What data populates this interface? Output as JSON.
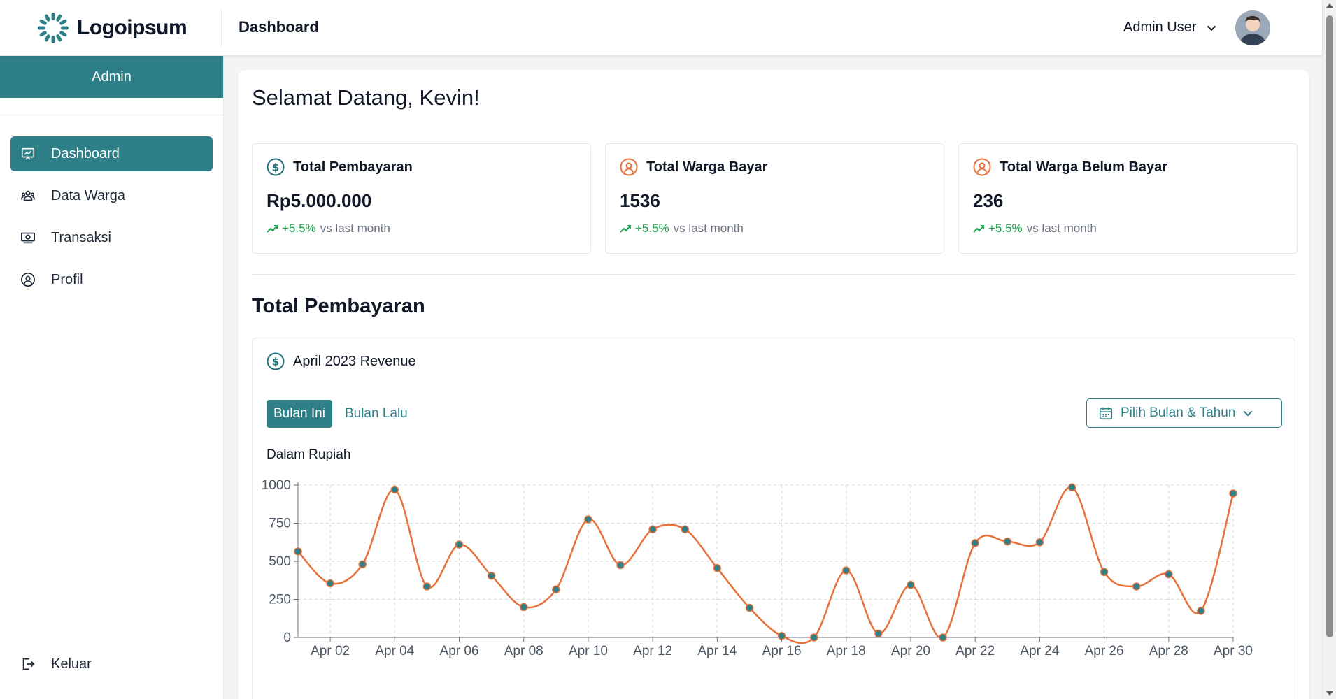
{
  "header": {
    "logo_text": "Logoipsum",
    "page_title": "Dashboard",
    "user_name": "Admin User"
  },
  "sidebar": {
    "role_label": "Admin",
    "items": [
      {
        "label": "Dashboard",
        "icon": "presentation-chart-icon",
        "active": true
      },
      {
        "label": "Data Warga",
        "icon": "users-icon",
        "active": false
      },
      {
        "label": "Transaksi",
        "icon": "money-icon",
        "active": false
      },
      {
        "label": "Profil",
        "icon": "user-circle-icon",
        "active": false
      }
    ],
    "logout_label": "Keluar"
  },
  "main": {
    "welcome": "Selamat Datang, Kevin!",
    "stats": [
      {
        "title": "Total Pembayaran",
        "value": "Rp5.000.000",
        "trend": "+5.5%",
        "trend_suffix": "vs last month",
        "icon": "dollar-circle-icon"
      },
      {
        "title": "Total Warga Bayar",
        "value": "1536",
        "trend": "+5.5%",
        "trend_suffix": "vs last month",
        "icon": "user-circle-icon"
      },
      {
        "title": "Total Warga Belum Bayar",
        "value": "236",
        "trend": "+5.5%",
        "trend_suffix": "vs last month",
        "icon": "user-circle-icon"
      }
    ],
    "section_title": "Total Pembayaran",
    "chart_card": {
      "heading": "April 2023 Revenue",
      "tabs": [
        "Bulan Ini",
        "Bulan Lalu"
      ],
      "active_tab": "Bulan Ini",
      "picker_label": "Pilih Bulan & Tahun",
      "unit_label": "Dalam Rupiah"
    }
  },
  "colors": {
    "accent": "#2f7f88",
    "line": "#e8703a",
    "point": "#2f7f88",
    "trend_up": "#16a34a",
    "stat_icon_primary": "#1f6f78",
    "stat_icon_secondary": "#e8703a"
  },
  "chart_data": {
    "type": "line",
    "title": "",
    "xlabel": "",
    "ylabel": "",
    "x": [
      "Apr 01",
      "Apr 02",
      "Apr 03",
      "Apr 04",
      "Apr 05",
      "Apr 06",
      "Apr 07",
      "Apr 08",
      "Apr 09",
      "Apr 10",
      "Apr 11",
      "Apr 12",
      "Apr 13",
      "Apr 14",
      "Apr 15",
      "Apr 16",
      "Apr 17",
      "Apr 18",
      "Apr 19",
      "Apr 20",
      "Apr 21",
      "Apr 22",
      "Apr 23",
      "Apr 24",
      "Apr 25",
      "Apr 26",
      "Apr 27",
      "Apr 28",
      "Apr 29",
      "Apr 30"
    ],
    "x_tick_labels": [
      "Apr 02",
      "Apr 04",
      "Apr 06",
      "Apr 08",
      "Apr 10",
      "Apr 12",
      "Apr 14",
      "Apr 16",
      "Apr 18",
      "Apr 20",
      "Apr 22",
      "Apr 24",
      "Apr 26",
      "Apr 28",
      "Apr 30"
    ],
    "series": [
      {
        "values": [
          565,
          355,
          480,
          970,
          335,
          610,
          405,
          200,
          315,
          775,
          475,
          710,
          710,
          455,
          195,
          10,
          0,
          440,
          25,
          345,
          0,
          620,
          630,
          625,
          985,
          430,
          335,
          415,
          175,
          945
        ]
      }
    ],
    "y_ticks": [
      0,
      250,
      500,
      750,
      1000
    ],
    "ylim": [
      0,
      1000
    ],
    "grid": true,
    "smooth": true
  }
}
